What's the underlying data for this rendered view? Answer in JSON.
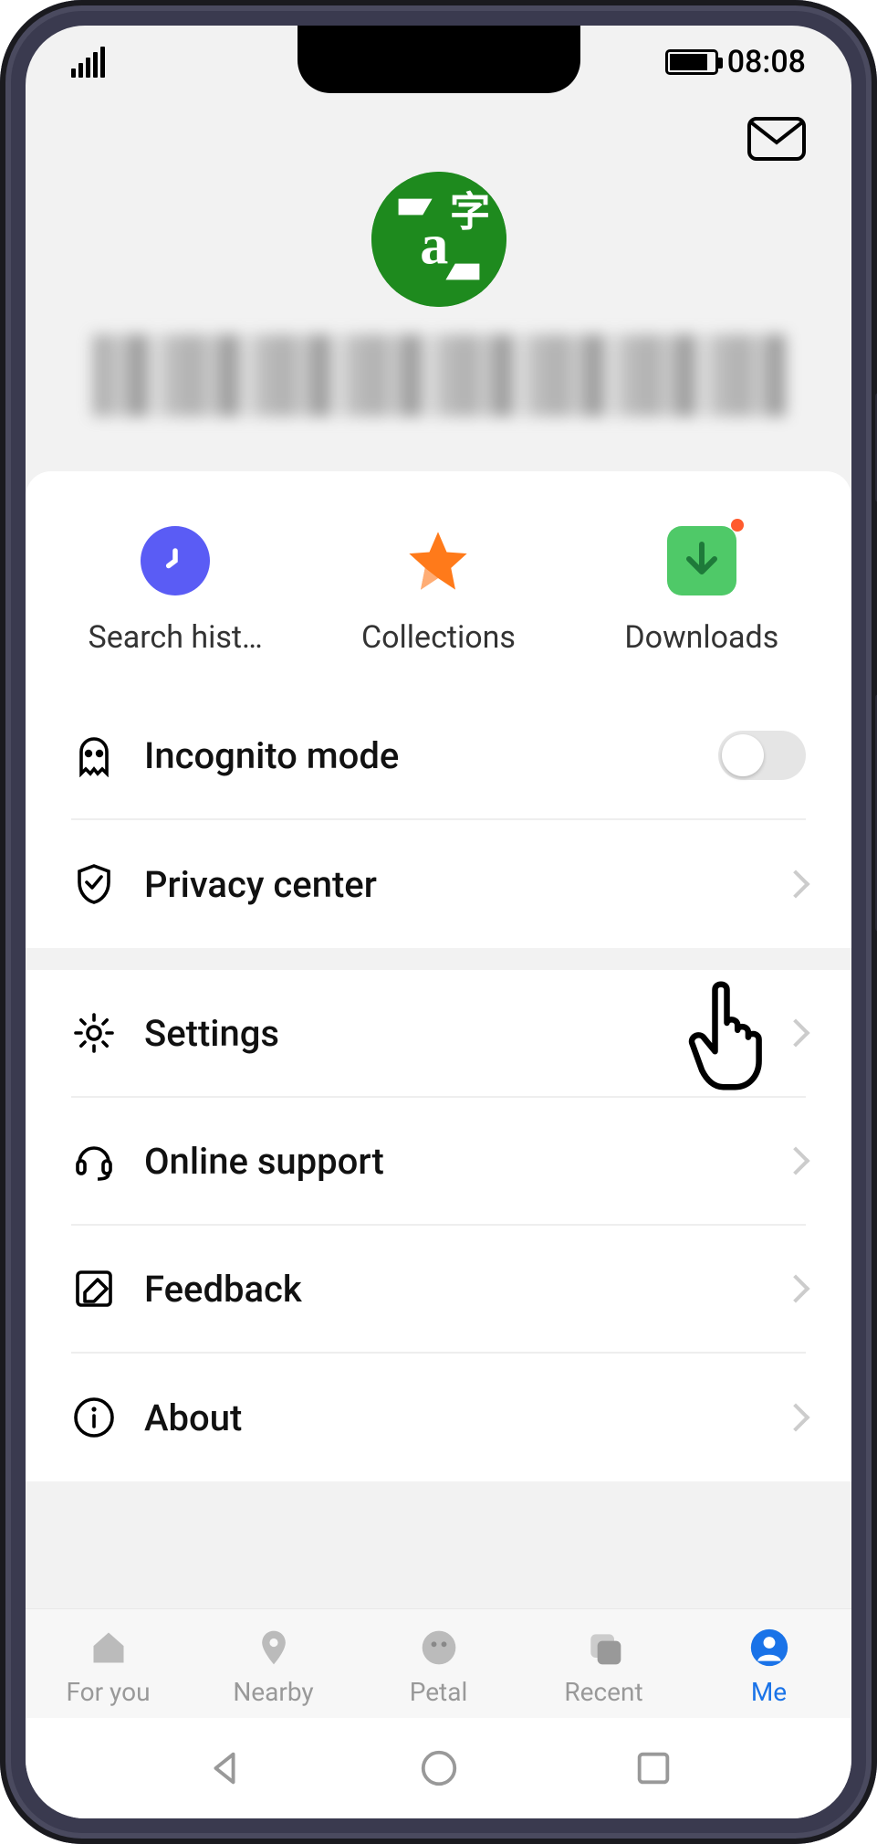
{
  "status": {
    "time": "08:08"
  },
  "quick": {
    "history_label": "Search hist…",
    "collections_label": "Collections",
    "downloads_label": "Downloads"
  },
  "menu": {
    "incognito_label": "Incognito mode",
    "privacy_label": "Privacy center",
    "settings_label": "Settings",
    "support_label": "Online support",
    "feedback_label": "Feedback",
    "about_label": "About"
  },
  "nav": {
    "foryou_label": "For you",
    "nearby_label": "Nearby",
    "petal_label": "Petal",
    "recent_label": "Recent",
    "me_label": "Me"
  },
  "colors": {
    "accent": "#1a73e8"
  }
}
